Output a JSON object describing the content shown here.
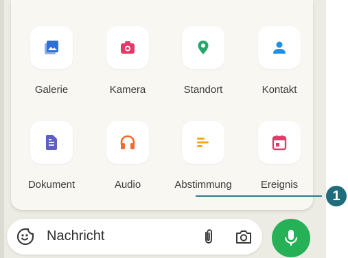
{
  "attach_menu": {
    "items": [
      {
        "label": "Galerie",
        "icon": "gallery-icon",
        "color": "#2f6fd6"
      },
      {
        "label": "Kamera",
        "icon": "camera-icon",
        "color": "#e5386a"
      },
      {
        "label": "Standort",
        "icon": "location-icon",
        "color": "#27a86a"
      },
      {
        "label": "Kontakt",
        "icon": "contact-icon",
        "color": "#1f8fe5"
      },
      {
        "label": "Dokument",
        "icon": "document-icon",
        "color": "#5b5fc7"
      },
      {
        "label": "Audio",
        "icon": "headphones-icon",
        "color": "#f26a2e"
      },
      {
        "label": "Abstimmung",
        "icon": "poll-icon",
        "color": "#f2a81d"
      },
      {
        "label": "Ereignis",
        "icon": "calendar-icon",
        "color": "#e23a6b"
      }
    ]
  },
  "composer": {
    "placeholder": "Nachricht"
  },
  "callout": {
    "number": "1"
  },
  "colors": {
    "accent_green": "#27b157",
    "callout": "#1f6d7c"
  }
}
